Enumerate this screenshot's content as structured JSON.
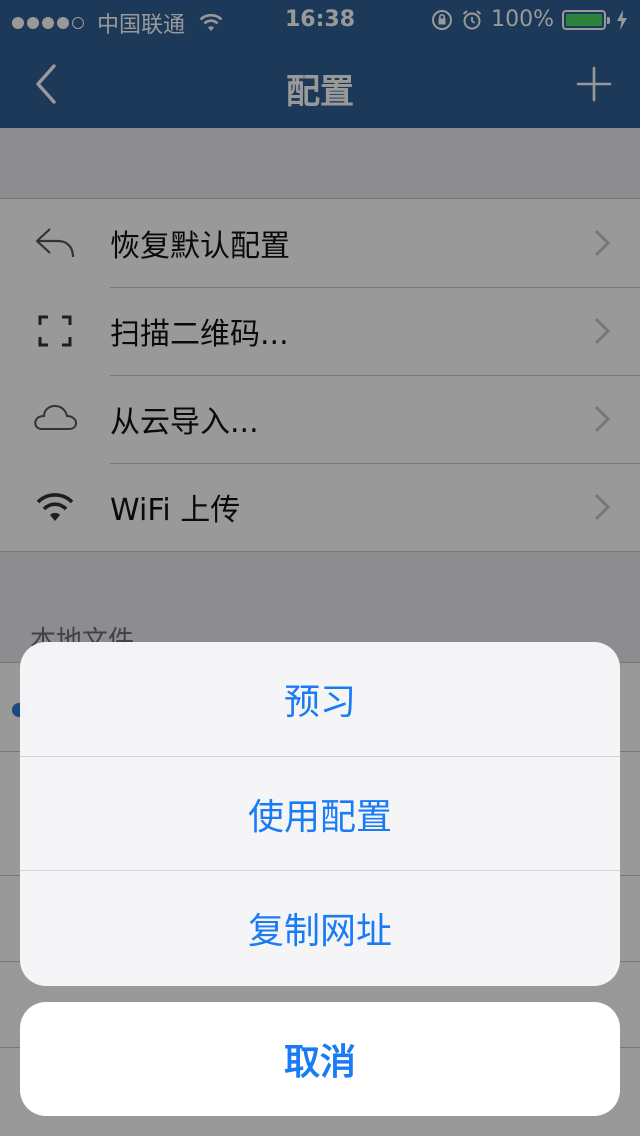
{
  "status_bar": {
    "carrier": "中国联通",
    "time": "16:38",
    "battery": "100%",
    "battery_level": 1.0,
    "signal_bars_filled": 4,
    "signal_bars_total": 5
  },
  "nav": {
    "title": "配置",
    "back_icon": "chevron-left-icon",
    "add_icon": "plus-icon"
  },
  "menu": {
    "items": [
      {
        "label": "恢复默认配置",
        "icon": "reply-arrow-icon"
      },
      {
        "label": "扫描二维码...",
        "icon": "scan-frame-icon"
      },
      {
        "label": "从云导入...",
        "icon": "cloud-icon"
      },
      {
        "label": "WiFi 上传",
        "icon": "wifi-icon"
      }
    ]
  },
  "local_files": {
    "section_title": "本地文件"
  },
  "action_sheet": {
    "options": [
      "预习",
      "使用配置",
      "复制网址"
    ],
    "cancel": "取消"
  },
  "colors": {
    "nav_bg": "#2f5f95",
    "accent": "#1a7cf5",
    "battery_green": "#4cd964"
  }
}
